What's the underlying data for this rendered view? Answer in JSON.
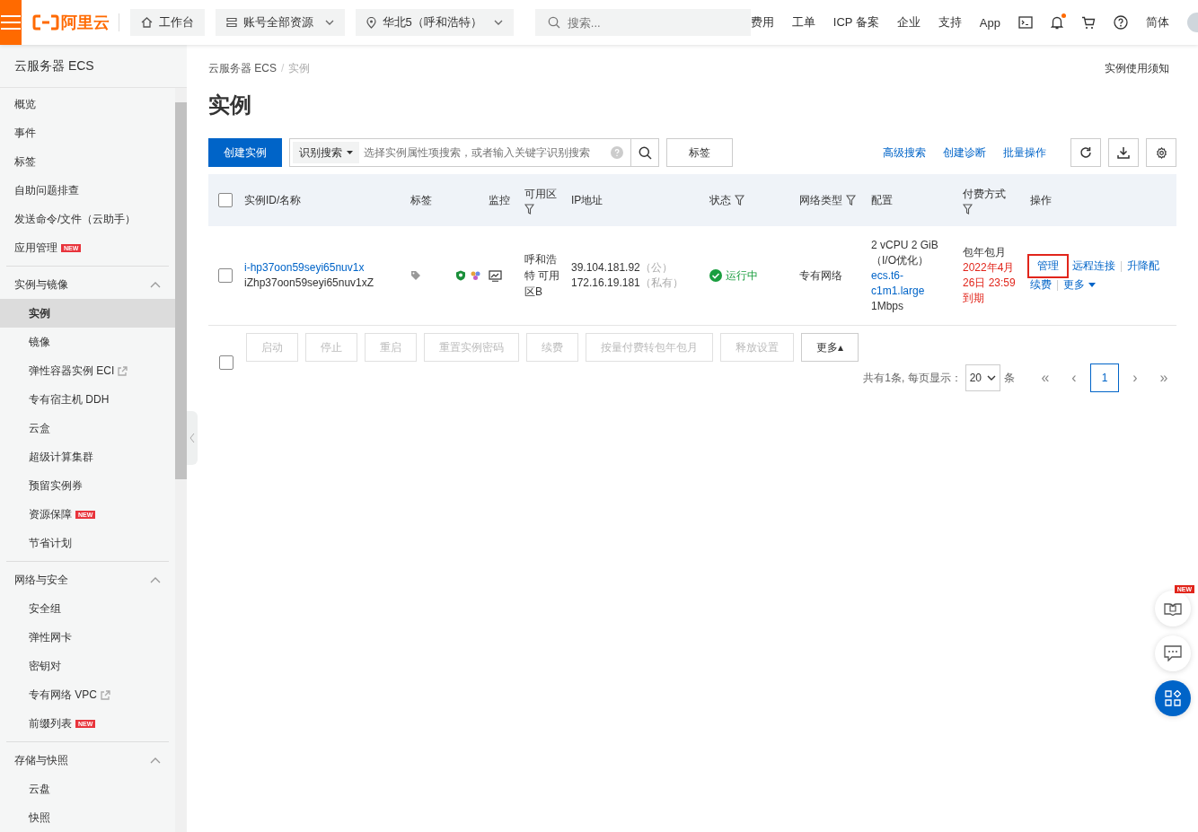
{
  "topbar": {
    "logo": "阿里云",
    "nav": [
      {
        "label": "工作台",
        "kind": "home",
        "dropdown": false
      },
      {
        "label": "账号全部资源",
        "kind": "stack",
        "dropdown": true
      },
      {
        "label": "华北5（呼和浩特）",
        "kind": "pin",
        "dropdown": true
      }
    ],
    "search": {
      "placeholder": "搜索..."
    },
    "links": [
      "费用",
      "工单",
      "ICP 备案",
      "企业",
      "支持",
      "App"
    ],
    "bell_unread": true,
    "language": "简体"
  },
  "sidebar": {
    "title": "云服务器 ECS",
    "items": [
      {
        "label": "概览",
        "selected": false,
        "external": false
      },
      {
        "label": "事件",
        "selected": false,
        "external": false
      },
      {
        "label": "标签",
        "selected": false,
        "external": false
      },
      {
        "label": "自助问题排查",
        "selected": false,
        "external": false
      },
      {
        "label": "发送命令/文件（云助手）",
        "selected": false,
        "external": false
      },
      {
        "label": "应用管理",
        "selected": false,
        "external": false,
        "badge": "NEW"
      }
    ],
    "groups": [
      {
        "title": "实例与镜像",
        "expanded": true,
        "items": [
          {
            "label": "实例",
            "selected": true,
            "external": false
          },
          {
            "label": "镜像",
            "selected": false,
            "external": false
          },
          {
            "label": "弹性容器实例 ECI",
            "selected": false,
            "external": true
          },
          {
            "label": "专有宿主机 DDH",
            "selected": false,
            "external": false
          },
          {
            "label": "云盒",
            "selected": false,
            "external": false
          },
          {
            "label": "超级计算集群",
            "selected": false,
            "external": false
          },
          {
            "label": "预留实例券",
            "selected": false,
            "external": false
          },
          {
            "label": "资源保障",
            "selected": false,
            "external": false,
            "badge": "NEW"
          },
          {
            "label": "节省计划",
            "selected": false,
            "external": false
          }
        ]
      },
      {
        "title": "网络与安全",
        "expanded": true,
        "items": [
          {
            "label": "安全组",
            "selected": false,
            "external": false
          },
          {
            "label": "弹性网卡",
            "selected": false,
            "external": false
          },
          {
            "label": "密钥对",
            "selected": false,
            "external": false
          },
          {
            "label": "专有网络 VPC",
            "selected": false,
            "external": true
          },
          {
            "label": "前缀列表",
            "selected": false,
            "external": false,
            "badge": "NEW"
          }
        ]
      },
      {
        "title": "存储与快照",
        "expanded": true,
        "items": [
          {
            "label": "云盘",
            "selected": false,
            "external": false
          },
          {
            "label": "快照",
            "selected": false,
            "external": false
          }
        ]
      }
    ]
  },
  "breadcrumb": {
    "items": [
      "云服务器 ECS",
      "实例"
    ],
    "separator": "/"
  },
  "notice_link": "实例使用须知",
  "page_title": "实例",
  "toolbar": {
    "create_button": "创建实例",
    "search_mode": "识别搜索",
    "search_placeholder": "选择实例属性项搜索，或者输入关键字识别搜索",
    "tag_button": "标签",
    "links": [
      "高级搜索",
      "创建诊断",
      "批量操作"
    ]
  },
  "table": {
    "select_all_checked": false,
    "columns": [
      {
        "label": "实例ID/名称",
        "filter": false
      },
      {
        "label": "标签",
        "filter": false
      },
      {
        "label": "监控",
        "filter": false
      },
      {
        "label": "可用区",
        "filter": true
      },
      {
        "label": "IP地址",
        "filter": false
      },
      {
        "label": "状态",
        "filter": true
      },
      {
        "label": "网络类型",
        "filter": true
      },
      {
        "label": "配置",
        "filter": false
      },
      {
        "label": "付费方式",
        "filter": true
      },
      {
        "label": "操作",
        "filter": false
      }
    ],
    "rows": [
      {
        "checked": false,
        "id": "i-hp37oon59seyi65nuv1x",
        "name": "iZhp37oon59seyi65nuv1xZ",
        "zone": "呼和浩特 可用区B",
        "public_ip": "39.104.181.92",
        "public_tag": "（公）",
        "private_ip": "172.16.19.181",
        "private_tag": "（私有）",
        "status": "运行中",
        "network": "专有网络",
        "spec": "2 vCPU 2 GiB",
        "spec_note": "（I/O优化）",
        "instance_type": "ecs.t6-c1m1.large",
        "bandwidth": "1Mbps",
        "billing": "包年包月",
        "expiry": "2022年4月26日 23:59到期",
        "actions": [
          [
            {
              "label": "管理",
              "highlighted": true,
              "dropdown": false
            },
            {
              "label": "远程连接",
              "highlighted": false,
              "dropdown": false
            },
            {
              "label": "升降配",
              "highlighted": false,
              "dropdown": false,
              "separator": "|"
            }
          ],
          [
            {
              "label": "续费",
              "highlighted": false,
              "dropdown": false
            },
            {
              "label": "更多",
              "highlighted": false,
              "dropdown": true,
              "separator": "|"
            }
          ]
        ]
      }
    ]
  },
  "footer": {
    "checked": false,
    "buttons": [
      {
        "label": "启动",
        "disabled": true
      },
      {
        "label": "停止",
        "disabled": true
      },
      {
        "label": "重启",
        "disabled": true
      },
      {
        "label": "重置实例密码",
        "disabled": true
      },
      {
        "label": "续费",
        "disabled": true
      },
      {
        "label": "按量付费转包年包月",
        "disabled": true
      },
      {
        "label": "释放设置",
        "disabled": true
      },
      {
        "label": "更多▴",
        "disabled": false
      }
    ],
    "pagination": {
      "summary": "共有1条, 每页显示：",
      "page_size": "20",
      "unit": "条",
      "first": "«",
      "prev": "‹",
      "pages": [
        {
          "label": "1",
          "selected": true
        }
      ],
      "next": "›",
      "last": "»"
    }
  },
  "floating": {
    "new_badge": "NEW"
  }
}
